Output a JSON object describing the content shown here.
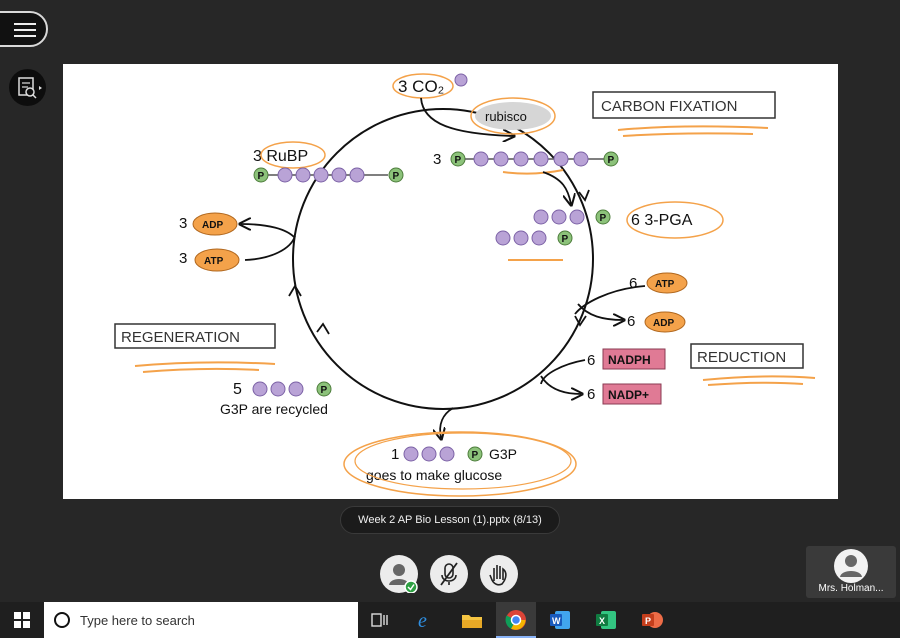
{
  "slide": {
    "co2": "3 CO₂",
    "rubisco": "rubisco",
    "carbon_fixation": "CARBON FIXATION",
    "three": "3",
    "rubp": "3 RuBP",
    "pga": "6 3-PGA",
    "adp_count": "3",
    "adp": "ADP",
    "atp_count": "3",
    "atp": "ATP",
    "atp6_count": "6",
    "atp6": "ATP",
    "adp6_count": "6",
    "adp6": "ADP",
    "nadph_count": "6",
    "nadph": "NADPH",
    "nadp_count": "6",
    "nadp": "NADP+",
    "reduction": "REDUCTION",
    "regeneration": "REGENERATION",
    "five": "5",
    "g3p_recycled": "G3P are recycled",
    "one": "1",
    "g3p": "G3P",
    "glucose": "goes to make glucose",
    "p": "P"
  },
  "caption": "Week 2 AP Bio Lesson (1).pptx   (8/13)",
  "participant": {
    "name": "Mrs. Holman..."
  },
  "taskbar": {
    "search_placeholder": "Type here to search"
  },
  "colors": {
    "accent_orange": "#f4a24a",
    "nadph_pink": "#e07a95",
    "molecule_purple": "#b9a3d6",
    "phosphate_green": "#8cc27a"
  }
}
